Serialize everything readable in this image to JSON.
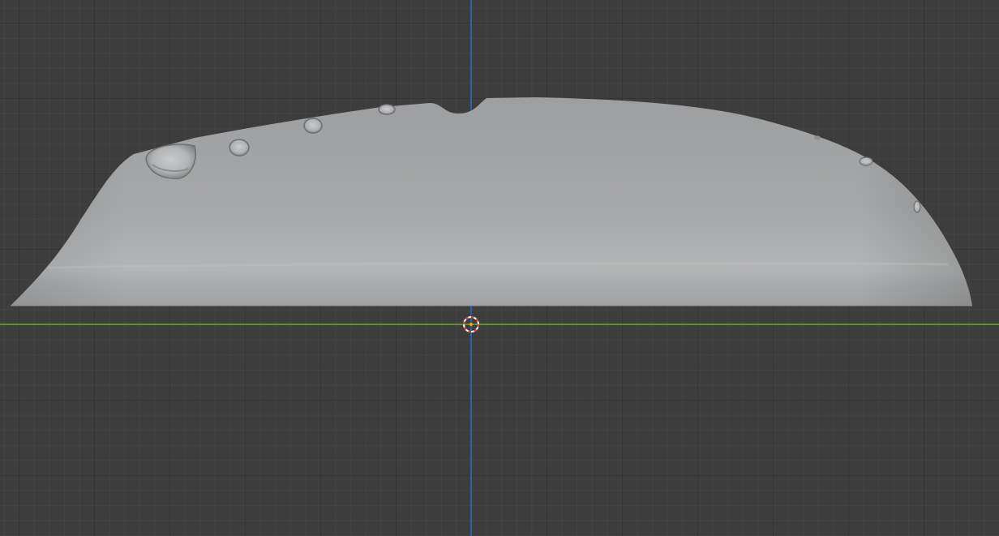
{
  "viewport": {
    "background_color": "#3d3d3d",
    "grid_color": "#333333",
    "x_axis_color": "#5f8f2a",
    "z_axis_color": "#2f5fa8"
  },
  "object": {
    "kind": "mesh",
    "shade_color": "#a9aaab"
  },
  "cursor_3d": {
    "icon": "3d-cursor-icon",
    "ring_colors": [
      "#ffffff",
      "#e03a2a"
    ]
  }
}
